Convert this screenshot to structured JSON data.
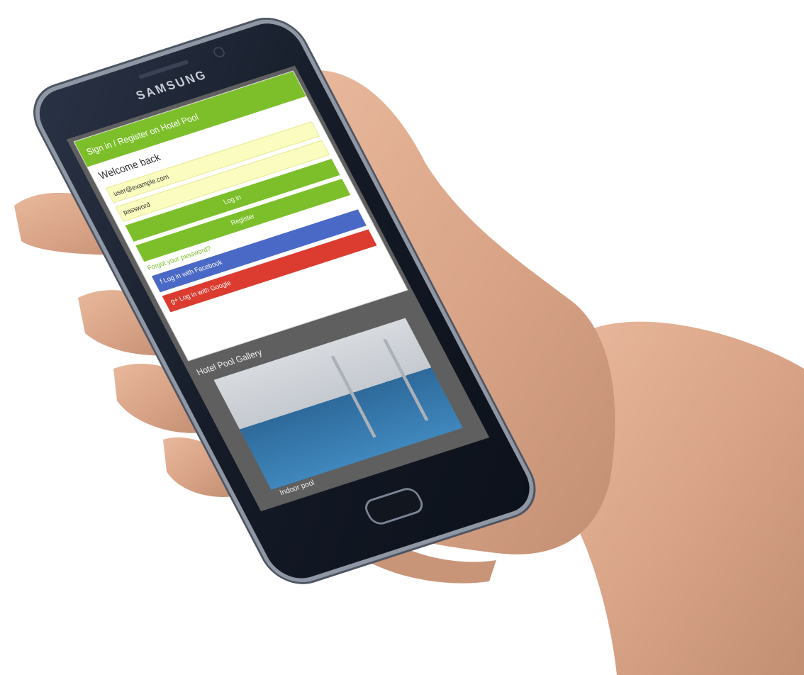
{
  "device": {
    "brand": "SAMSUNG"
  },
  "dialog": {
    "header": "Sign in / Register on Hotel Pool",
    "title": "Welcome back",
    "fields": [
      {
        "value": "user@example.com"
      },
      {
        "value": "password"
      }
    ],
    "buttons": {
      "login": "Log in",
      "register": "Register",
      "facebook": "f  Log in with Facebook",
      "google": "g+  Log in with Google"
    },
    "link": "Forgot your password?"
  },
  "gallery": {
    "title": "Hotel Pool Gallery",
    "caption": "Indoor pool"
  },
  "colors": {
    "accent": "#7cbf2a",
    "facebook": "#4a68c6",
    "google": "#dc3b2f",
    "field_bg": "#fbfdc0"
  }
}
